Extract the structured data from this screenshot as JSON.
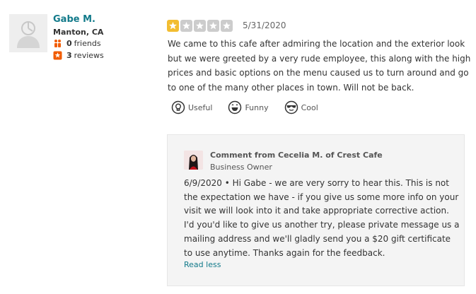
{
  "reviewer": {
    "name": "Gabe M.",
    "location": "Manton, CA",
    "friends_count": "0",
    "friends_label": "friends",
    "reviews_count": "3",
    "reviews_label": "reviews"
  },
  "review": {
    "rating": 1,
    "max_rating": 5,
    "star_color": "#f2bd31",
    "date": "5/31/2020",
    "text": "We came to this cafe after admiring the location and the exterior look but we were greeted by a very rude employee, this along with the high prices and basic options on the menu caused us to turn around and go to one of the many other places in town. Will not be back."
  },
  "reactions": [
    {
      "label": "Useful",
      "icon": "lightbulb-icon"
    },
    {
      "label": "Funny",
      "icon": "smile-icon"
    },
    {
      "label": "Cool",
      "icon": "sunglasses-icon"
    }
  ],
  "owner_comment": {
    "title": "Comment from Cecelia M. of Crest Cafe",
    "role": "Business Owner",
    "text": "6/9/2020 • Hi Gabe - we are very sorry to hear this. This is not the expectation we have - if you give us some more info on your visit we will  look into it and take appropriate corrective action. I'd you'd like to give us another try, please private message us a mailing address and we'll gladly send you a $20 gift certificate to use anytime. Thanks again for the feedback.",
    "read_less": "Read less"
  },
  "colors": {
    "link": "#127a8a",
    "friends_icon": "#f15c00",
    "reviews_icon": "#f15c00"
  }
}
